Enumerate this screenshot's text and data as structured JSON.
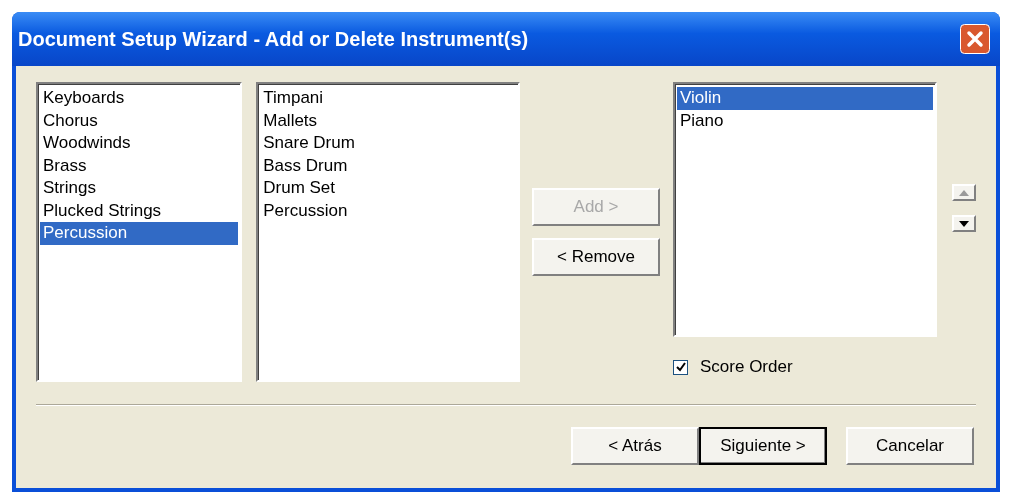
{
  "window": {
    "title": "Document Setup Wizard - Add or Delete Instrument(s)"
  },
  "families": [
    {
      "label": "Keyboards",
      "selected": false
    },
    {
      "label": "Chorus",
      "selected": false
    },
    {
      "label": "Woodwinds",
      "selected": false
    },
    {
      "label": "Brass",
      "selected": false
    },
    {
      "label": "Strings",
      "selected": false
    },
    {
      "label": "Plucked Strings",
      "selected": false
    },
    {
      "label": "Percussion",
      "selected": true
    }
  ],
  "instruments": [
    {
      "label": "Timpani",
      "selected": false
    },
    {
      "label": "Mallets",
      "selected": false
    },
    {
      "label": "Snare Drum",
      "selected": false
    },
    {
      "label": "Bass Drum",
      "selected": false
    },
    {
      "label": "Drum Set",
      "selected": false
    },
    {
      "label": "Percussion",
      "selected": false
    }
  ],
  "transfer_buttons": [
    {
      "label": "Add >",
      "disabled": true
    },
    {
      "label": "< Remove",
      "disabled": false
    }
  ],
  "score": [
    {
      "label": "Violin",
      "selected": true
    },
    {
      "label": "Piano",
      "selected": false
    }
  ],
  "order_buttons": [
    {
      "kind": "up",
      "disabled": true
    },
    {
      "kind": "down",
      "disabled": false
    }
  ],
  "score_order": {
    "label": "Score Order",
    "checked": true
  },
  "buttons": [
    {
      "label": "< Atrás",
      "default": false
    },
    {
      "label": "Siguiente >",
      "default": true
    },
    {
      "label": "Cancelar",
      "default": false
    }
  ]
}
